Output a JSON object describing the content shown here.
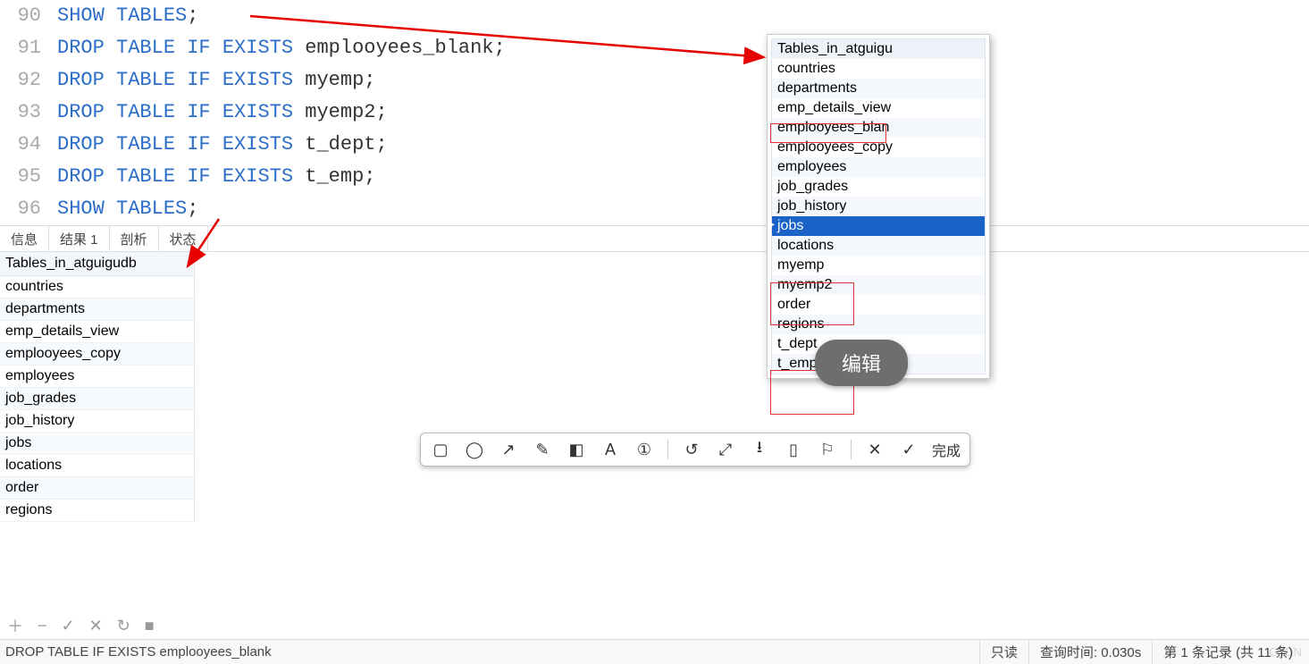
{
  "editor": {
    "lines": [
      {
        "ln": "90",
        "tokens": [
          [
            "kw",
            "SHOW"
          ],
          [
            "sp",
            " "
          ],
          [
            "kw",
            "TABLES"
          ],
          [
            "pn",
            ";"
          ]
        ]
      },
      {
        "ln": "91",
        "tokens": [
          [
            "kw",
            "DROP"
          ],
          [
            "sp",
            " "
          ],
          [
            "kw",
            "TABLE"
          ],
          [
            "sp",
            " "
          ],
          [
            "kw",
            "IF"
          ],
          [
            "sp",
            " "
          ],
          [
            "kw",
            "EXISTS"
          ],
          [
            "sp",
            " "
          ],
          [
            "id",
            "emplooyees_blank"
          ],
          [
            "pn",
            ";"
          ]
        ]
      },
      {
        "ln": "92",
        "tokens": [
          [
            "kw",
            "DROP"
          ],
          [
            "sp",
            " "
          ],
          [
            "kw",
            "TABLE"
          ],
          [
            "sp",
            " "
          ],
          [
            "kw",
            "IF"
          ],
          [
            "sp",
            " "
          ],
          [
            "kw",
            "EXISTS"
          ],
          [
            "sp",
            " "
          ],
          [
            "id",
            "myemp"
          ],
          [
            "pn",
            ";"
          ]
        ]
      },
      {
        "ln": "93",
        "tokens": [
          [
            "kw",
            "DROP"
          ],
          [
            "sp",
            " "
          ],
          [
            "kw",
            "TABLE"
          ],
          [
            "sp",
            " "
          ],
          [
            "kw",
            "IF"
          ],
          [
            "sp",
            " "
          ],
          [
            "kw",
            "EXISTS"
          ],
          [
            "sp",
            " "
          ],
          [
            "id",
            "myemp2"
          ],
          [
            "pn",
            ";"
          ]
        ]
      },
      {
        "ln": "94",
        "tokens": [
          [
            "kw",
            "DROP"
          ],
          [
            "sp",
            " "
          ],
          [
            "kw",
            "TABLE"
          ],
          [
            "sp",
            " "
          ],
          [
            "kw",
            "IF"
          ],
          [
            "sp",
            " "
          ],
          [
            "kw",
            "EXISTS"
          ],
          [
            "sp",
            " "
          ],
          [
            "id",
            "t_dept"
          ],
          [
            "pn",
            ";"
          ]
        ]
      },
      {
        "ln": "95",
        "tokens": [
          [
            "kw",
            "DROP"
          ],
          [
            "sp",
            " "
          ],
          [
            "kw",
            "TABLE"
          ],
          [
            "sp",
            " "
          ],
          [
            "kw",
            "IF"
          ],
          [
            "sp",
            " "
          ],
          [
            "kw",
            "EXISTS"
          ],
          [
            "sp",
            " "
          ],
          [
            "id",
            "t_emp"
          ],
          [
            "pn",
            ";"
          ]
        ]
      },
      {
        "ln": "96",
        "tokens": [
          [
            "kw",
            "SHOW"
          ],
          [
            "sp",
            " "
          ],
          [
            "kw",
            "TABLES"
          ],
          [
            "pn",
            ";"
          ]
        ]
      }
    ]
  },
  "tabs": {
    "items": [
      "信息",
      "结果 1",
      "剖析",
      "状态"
    ],
    "active": 1
  },
  "grid": {
    "header": "Tables_in_atguigudb",
    "rows": [
      "countries",
      "departments",
      "emp_details_view",
      "emplooyees_copy",
      "employees",
      "job_grades",
      "job_history",
      "jobs",
      "locations",
      "order",
      "regions"
    ]
  },
  "popup": {
    "header": "Tables_in_atguigu",
    "rows": [
      {
        "t": "countries"
      },
      {
        "t": "departments"
      },
      {
        "t": "emp_details_view"
      },
      {
        "t": "emplooyees_blan",
        "boxed": true
      },
      {
        "t": "emplooyees_copy"
      },
      {
        "t": "employees"
      },
      {
        "t": "job_grades"
      },
      {
        "t": "job_history"
      },
      {
        "t": "jobs",
        "sel": true
      },
      {
        "t": "locations"
      },
      {
        "t": "myemp",
        "boxed": true
      },
      {
        "t": "myemp2",
        "boxed": true
      },
      {
        "t": "order"
      },
      {
        "t": "regions"
      },
      {
        "t": "t_dept",
        "boxed": true
      },
      {
        "t": "t_emp",
        "boxed": true
      }
    ]
  },
  "edit_badge": "编辑",
  "anno_done": "完成",
  "bottom_tools": {
    "items": [
      "＋",
      "−",
      "✓",
      "✕",
      "↻",
      "■"
    ]
  },
  "status": {
    "sql": "DROP TABLE IF EXISTS emplooyees_blank",
    "readonly": "只读",
    "query_time": "查询时间: 0.030s",
    "record": "第 1 条记录 (共 11 条)"
  },
  "watermark": "CSDN"
}
